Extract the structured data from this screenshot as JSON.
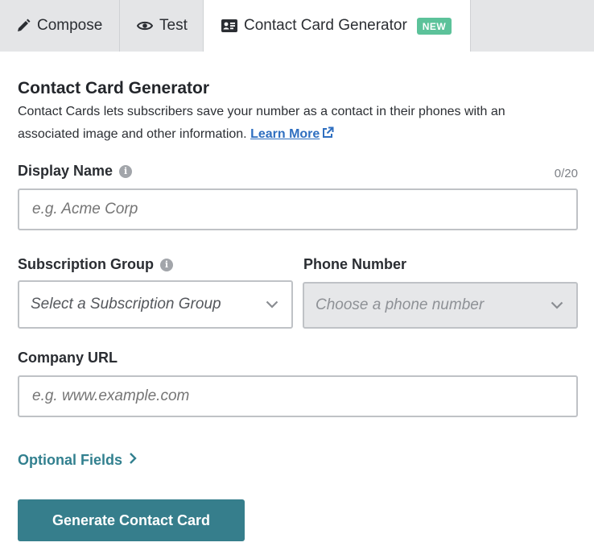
{
  "tabs": {
    "compose": "Compose",
    "test": "Test",
    "generator": "Contact Card Generator",
    "new_badge": "NEW"
  },
  "header": {
    "title": "Contact Card Generator",
    "description": "Contact Cards lets subscribers save your number as a contact in their phones with an associated image and other information.",
    "learn_more": "Learn More"
  },
  "display_name": {
    "label": "Display Name",
    "counter": "0/20",
    "placeholder": "e.g. Acme Corp",
    "value": ""
  },
  "subscription_group": {
    "label": "Subscription Group",
    "selected": "Select a Subscription Group"
  },
  "phone_number": {
    "label": "Phone Number",
    "selected": "Choose a phone number",
    "disabled": true
  },
  "company_url": {
    "label": "Company URL",
    "placeholder": "e.g. www.example.com",
    "value": ""
  },
  "optional_fields": "Optional Fields",
  "generate_button": "Generate Contact Card",
  "colors": {
    "accent": "#367e8c",
    "link": "#2f6fc0",
    "badge": "#5cc29a"
  },
  "icons": {
    "compose": "pencil-icon",
    "test": "eye-icon",
    "generator": "contact-card-icon",
    "info": "info-icon",
    "external": "external-link-icon",
    "chevron_down": "chevron-down-icon",
    "chevron_right": "chevron-right-icon"
  }
}
